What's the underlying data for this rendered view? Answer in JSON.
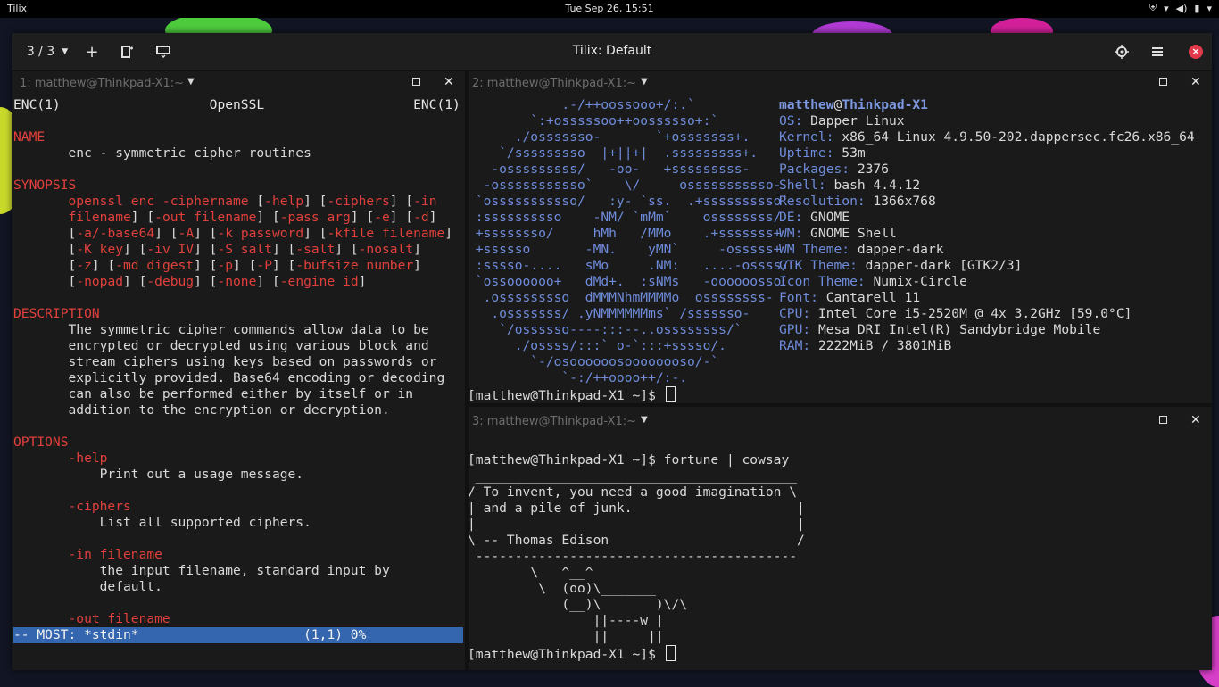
{
  "topbar": {
    "app_name": "Tilix",
    "clock": "Tue Sep 26, 15:51",
    "tray_icons": [
      "vpn-icon",
      "wifi-icon",
      "volume-icon",
      "power-icon"
    ]
  },
  "window": {
    "title": "Tilix: Default",
    "session_counter": "3 / 3",
    "buttons": [
      "add-terminal",
      "split-terminal",
      "sync-input",
      "find",
      "menu",
      "close"
    ]
  },
  "pane1": {
    "title": "1: matthew@Thinkpad-X1:~",
    "lines": [
      [
        {
          "t": "ENC(1)                   OpenSSL                   ENC(1)",
          "c": "white"
        }
      ],
      [
        {
          "t": "",
          "c": ""
        }
      ],
      [
        {
          "t": "NAME",
          "c": "red"
        }
      ],
      [
        {
          "t": "       enc - symmetric cipher routines",
          "c": ""
        }
      ],
      [
        {
          "t": "",
          "c": ""
        }
      ],
      [
        {
          "t": "SYNOPSIS",
          "c": "red"
        }
      ],
      [
        {
          "t": "       openssl enc -ciphername ",
          "c": "red"
        },
        {
          "t": "[",
          "c": ""
        },
        {
          "t": "-help",
          "c": "red"
        },
        {
          "t": "] [",
          "c": ""
        },
        {
          "t": "-ciphers",
          "c": "red"
        },
        {
          "t": "] [",
          "c": ""
        },
        {
          "t": "-in",
          "c": "red"
        }
      ],
      [
        {
          "t": "       filename",
          "c": "red"
        },
        {
          "t": "] [",
          "c": ""
        },
        {
          "t": "-out filename",
          "c": "red"
        },
        {
          "t": "] [",
          "c": ""
        },
        {
          "t": "-pass arg",
          "c": "red"
        },
        {
          "t": "] [",
          "c": ""
        },
        {
          "t": "-e",
          "c": "red"
        },
        {
          "t": "] [",
          "c": ""
        },
        {
          "t": "-d",
          "c": "red"
        },
        {
          "t": "]",
          "c": ""
        }
      ],
      [
        {
          "t": "       [",
          "c": ""
        },
        {
          "t": "-a/-base64",
          "c": "red"
        },
        {
          "t": "] [",
          "c": ""
        },
        {
          "t": "-A",
          "c": "red"
        },
        {
          "t": "] [",
          "c": ""
        },
        {
          "t": "-k password",
          "c": "red"
        },
        {
          "t": "] [",
          "c": ""
        },
        {
          "t": "-kfile filename",
          "c": "red"
        },
        {
          "t": "]",
          "c": ""
        }
      ],
      [
        {
          "t": "       [",
          "c": ""
        },
        {
          "t": "-K key",
          "c": "red"
        },
        {
          "t": "] [",
          "c": ""
        },
        {
          "t": "-iv IV",
          "c": "red"
        },
        {
          "t": "] [",
          "c": ""
        },
        {
          "t": "-S salt",
          "c": "red"
        },
        {
          "t": "] [",
          "c": ""
        },
        {
          "t": "-salt",
          "c": "red"
        },
        {
          "t": "] [",
          "c": ""
        },
        {
          "t": "-nosalt",
          "c": "red"
        },
        {
          "t": "]",
          "c": ""
        }
      ],
      [
        {
          "t": "       [",
          "c": ""
        },
        {
          "t": "-z",
          "c": "red"
        },
        {
          "t": "] [",
          "c": ""
        },
        {
          "t": "-md digest",
          "c": "red"
        },
        {
          "t": "] [",
          "c": ""
        },
        {
          "t": "-p",
          "c": "red"
        },
        {
          "t": "] [",
          "c": ""
        },
        {
          "t": "-P",
          "c": "red"
        },
        {
          "t": "] [",
          "c": ""
        },
        {
          "t": "-bufsize number",
          "c": "red"
        },
        {
          "t": "]",
          "c": ""
        }
      ],
      [
        {
          "t": "       [",
          "c": ""
        },
        {
          "t": "-nopad",
          "c": "red"
        },
        {
          "t": "] [",
          "c": ""
        },
        {
          "t": "-debug",
          "c": "red"
        },
        {
          "t": "] [",
          "c": ""
        },
        {
          "t": "-none",
          "c": "red"
        },
        {
          "t": "] [",
          "c": ""
        },
        {
          "t": "-engine id",
          "c": "red"
        },
        {
          "t": "]",
          "c": ""
        }
      ],
      [
        {
          "t": "",
          "c": ""
        }
      ],
      [
        {
          "t": "DESCRIPTION",
          "c": "red"
        }
      ],
      [
        {
          "t": "       The symmetric cipher commands allow data to be",
          "c": ""
        }
      ],
      [
        {
          "t": "       encrypted or decrypted using various block and",
          "c": ""
        }
      ],
      [
        {
          "t": "       stream ciphers using keys based on passwords or",
          "c": ""
        }
      ],
      [
        {
          "t": "       explicitly provided. Base64 encoding or decoding",
          "c": ""
        }
      ],
      [
        {
          "t": "       can also be performed either by itself or in",
          "c": ""
        }
      ],
      [
        {
          "t": "       addition to the encryption or decryption.",
          "c": ""
        }
      ],
      [
        {
          "t": "",
          "c": ""
        }
      ],
      [
        {
          "t": "OPTIONS",
          "c": "red"
        }
      ],
      [
        {
          "t": "       -help",
          "c": "red"
        }
      ],
      [
        {
          "t": "           Print out a usage message.",
          "c": ""
        }
      ],
      [
        {
          "t": "",
          "c": ""
        }
      ],
      [
        {
          "t": "       -ciphers",
          "c": "red"
        }
      ],
      [
        {
          "t": "           List all supported ciphers.",
          "c": ""
        }
      ],
      [
        {
          "t": "",
          "c": ""
        }
      ],
      [
        {
          "t": "       -in filename",
          "c": "red"
        }
      ],
      [
        {
          "t": "           the input filename, standard input by",
          "c": ""
        }
      ],
      [
        {
          "t": "           default.",
          "c": ""
        }
      ],
      [
        {
          "t": "",
          "c": ""
        }
      ],
      [
        {
          "t": "       -out filename",
          "c": "red"
        }
      ]
    ],
    "status": "-- MOST: *stdin*                     (1,1) 0%"
  },
  "pane2": {
    "title": "2: matthew@Thinkpad-X1:~",
    "logo": [
      "            .-/++oossooo+/:.`",
      "        `:+osssssoo++oossssso+:`",
      "      ./osssssso-       `+osssssss+.",
      "    `/sssssssso  |+||+|  .sssssssss+.",
      "   -osssssssss/   -oo-   +sssssssss-",
      "  -osssssssssso`    \\/     osssssssssso-",
      " `osssssssssso/   :y- `ss.  .+ssssssssso`",
      " :ssssssssso    -NM/ `mMm`    ossssssss/",
      " +ssssssso/     hMh   /MMo    .+sssssss+",
      " +ssssso       -MN.    yMN`     -osssss+",
      " :sssso-....   sMo     .NM:   ....-ossss/",
      " `ossoooooo+   dMd+.  :sNMs   -oooooosso`",
      "  .osssssssso  dMMMNhmMMMMo  ossssssss-",
      "   .osssssss/ .yNMMMMMMms` /sssssso-",
      "    `/ossssso----:::--..ossssssss/`",
      "      ./ossss/:::` o-`:::+sssso/.",
      "        `-/osoooooosoooooooso/-`",
      "            `-:/++oooo++/:-."
    ],
    "info_user": "matthew",
    "info_host": "Thinkpad-X1",
    "info": [
      {
        "k": "OS:",
        "v": "Dapper Linux"
      },
      {
        "k": "Kernel:",
        "v": "x86_64 Linux 4.9.50-202.dappersec.fc26.x86_64"
      },
      {
        "k": "Uptime:",
        "v": "53m"
      },
      {
        "k": "Packages:",
        "v": "2376"
      },
      {
        "k": "Shell:",
        "v": "bash 4.4.12"
      },
      {
        "k": "Resolution:",
        "v": "1366x768"
      },
      {
        "k": "DE:",
        "v": "GNOME"
      },
      {
        "k": "WM:",
        "v": "GNOME Shell"
      },
      {
        "k": "WM Theme:",
        "v": "dapper-dark"
      },
      {
        "k": "GTK Theme:",
        "v": "dapper-dark [GTK2/3]"
      },
      {
        "k": "Icon Theme:",
        "v": "Numix-Circle"
      },
      {
        "k": "Font:",
        "v": "Cantarell 11"
      },
      {
        "k": "CPU:",
        "v": "Intel Core i5-2520M @ 4x 3.2GHz [59.0°C]"
      },
      {
        "k": "GPU:",
        "v": "Mesa DRI Intel(R) Sandybridge Mobile"
      },
      {
        "k": "RAM:",
        "v": "2222MiB / 3801MiB"
      }
    ],
    "prompt": "[matthew@Thinkpad-X1 ~]$ "
  },
  "pane3": {
    "title": "3: matthew@Thinkpad-X1:~",
    "lines": [
      "",
      "[matthew@Thinkpad-X1 ~]$ fortune | cowsay",
      " _________________________________________",
      "/ To invent, you need a good imagination \\",
      "| and a pile of junk.                     |",
      "|                                         |",
      "\\ -- Thomas Edison                        /",
      " -----------------------------------------",
      "        \\   ^__^",
      "         \\  (oo)\\_______",
      "            (__)\\       )\\/\\",
      "                ||----w |",
      "                ||     ||"
    ],
    "prompt": "[matthew@Thinkpad-X1 ~]$ "
  },
  "colors": {
    "accent_blue": "#3466b0",
    "man_red": "#e0403c",
    "logo_blue": "#6f8cdb",
    "close_red": "#e0394a"
  }
}
